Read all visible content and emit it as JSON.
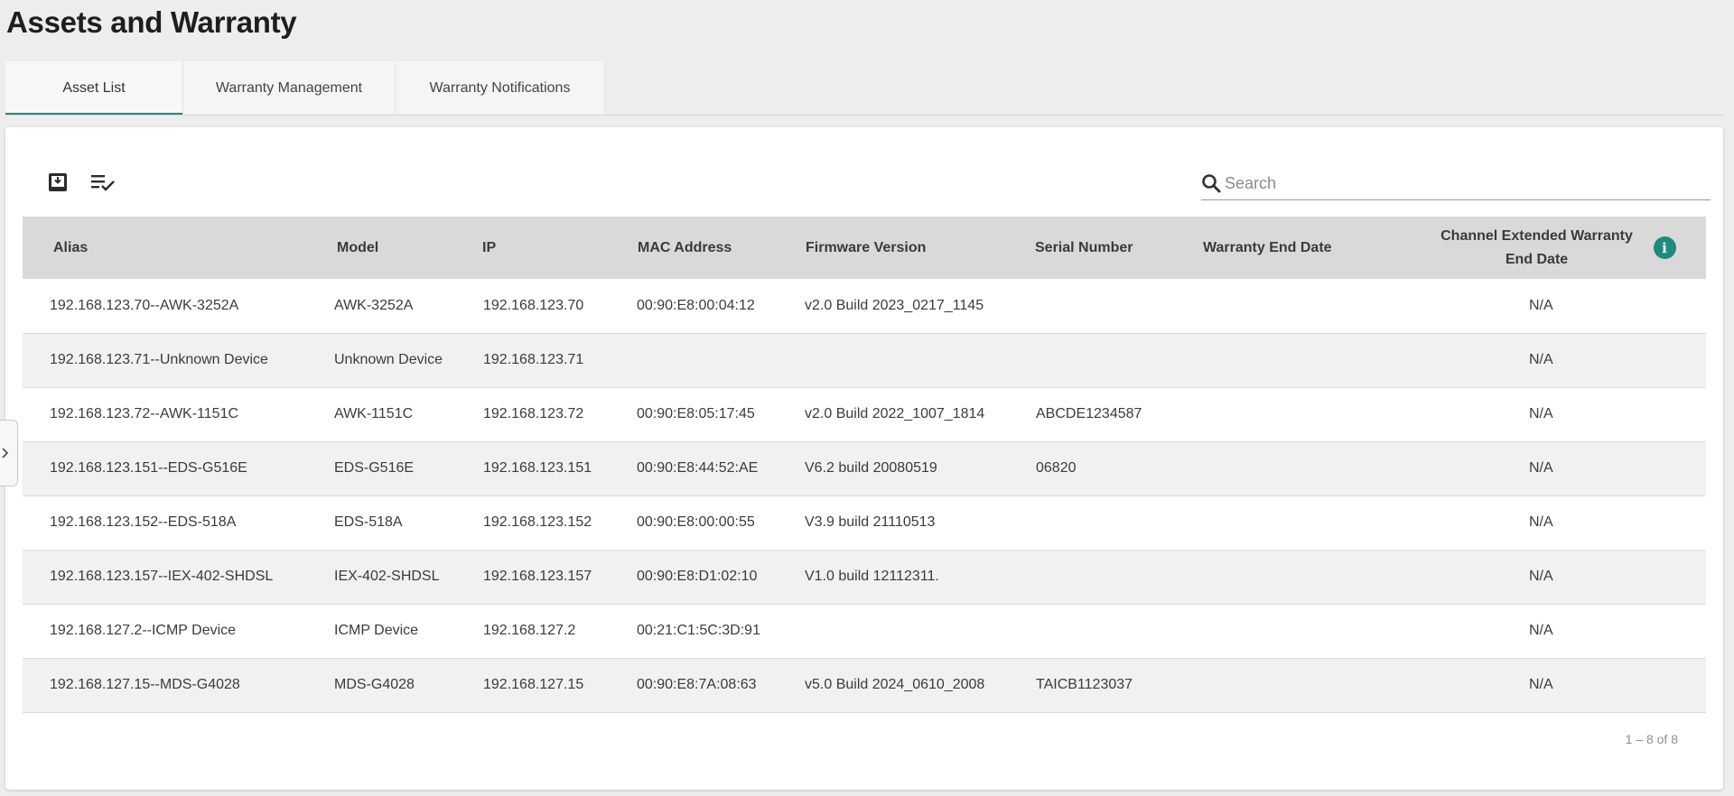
{
  "page": {
    "title": "Assets and Warranty"
  },
  "tabs": [
    {
      "label": "Asset List",
      "active": true
    },
    {
      "label": "Warranty Management",
      "active": false
    },
    {
      "label": "Warranty Notifications",
      "active": false
    }
  ],
  "toolbar": {
    "icons": [
      "import-icon",
      "column-select-icon"
    ],
    "search_placeholder": "Search"
  },
  "table": {
    "columns": [
      "Alias",
      "Model",
      "IP",
      "MAC Address",
      "Firmware Version",
      "Serial Number",
      "Warranty End Date",
      "Channel Extended Warranty End Date"
    ],
    "rows": [
      [
        "192.168.123.70--AWK-3252A",
        "AWK-3252A",
        "192.168.123.70",
        "00:90:E8:00:04:12",
        "v2.0 Build 2023_0217_1145",
        "",
        "",
        "N/A"
      ],
      [
        "192.168.123.71--Unknown Device",
        "Unknown Device",
        "192.168.123.71",
        "",
        "",
        "",
        "",
        "N/A"
      ],
      [
        "192.168.123.72--AWK-1151C",
        "AWK-1151C",
        "192.168.123.72",
        "00:90:E8:05:17:45",
        "v2.0 Build 2022_1007_1814",
        "ABCDE1234587",
        "",
        "N/A"
      ],
      [
        "192.168.123.151--EDS-G516E",
        "EDS-G516E",
        "192.168.123.151",
        "00:90:E8:44:52:AE",
        "V6.2  build 20080519",
        "06820",
        "",
        "N/A"
      ],
      [
        "192.168.123.152--EDS-518A",
        "EDS-518A",
        "192.168.123.152",
        "00:90:E8:00:00:55",
        "V3.9 build 21110513",
        "",
        "",
        "N/A"
      ],
      [
        "192.168.123.157--IEX-402-SHDSL",
        "IEX-402-SHDSL",
        "192.168.123.157",
        "00:90:E8:D1:02:10",
        "V1.0 build 12112311.",
        "",
        "",
        "N/A"
      ],
      [
        "192.168.127.2--ICMP Device",
        "ICMP Device",
        "192.168.127.2",
        "00:21:C1:5C:3D:91",
        "",
        "",
        "",
        "N/A"
      ],
      [
        "192.168.127.15--MDS-G4028",
        "MDS-G4028",
        "192.168.127.15",
        "00:90:E8:7A:08:63",
        "v5.0 Build 2024_0610_2008",
        "TAICB1123037",
        "",
        "N/A"
      ]
    ]
  },
  "pagination": {
    "text": "1 – 8 of 8"
  },
  "colors": {
    "accent": "#1f8a7f",
    "header_bg": "#d9d9d9",
    "page_bg": "#ededed"
  }
}
